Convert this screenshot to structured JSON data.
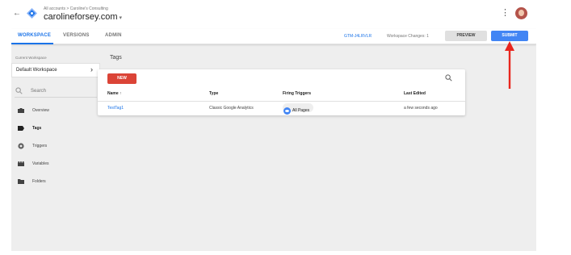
{
  "header": {
    "back_icon": "arrow-left-icon",
    "logo_icon": "gtm-diamond-logo",
    "breadcrumb": "All accounts > Caroline's Consulting",
    "container_name": "carolineforsey.com",
    "container_caret": "▾",
    "menu_icon": "kebab-menu-icon",
    "avatar_icon": "user-avatar"
  },
  "nav": {
    "tabs": [
      {
        "label": "WORKSPACE",
        "active": true
      },
      {
        "label": "VERSIONS",
        "active": false
      },
      {
        "label": "ADMIN",
        "active": false
      }
    ],
    "container_id": "GTM-J4LRVLR",
    "workspace_changes": "Workspace Changes: 1",
    "preview_label": "PREVIEW",
    "submit_label": "SUBMIT"
  },
  "sidebar": {
    "current_workspace_label": "Current Workspace",
    "workspace_name": "Default Workspace",
    "workspace_chevron": "›",
    "search_label": "Search",
    "items": [
      {
        "label": "Overview",
        "icon": "briefcase-icon",
        "active": false
      },
      {
        "label": "Tags",
        "icon": "tag-icon",
        "active": true
      },
      {
        "label": "Triggers",
        "icon": "trigger-icon",
        "active": false
      },
      {
        "label": "Variables",
        "icon": "variables-icon",
        "active": false
      },
      {
        "label": "Folders",
        "icon": "folder-icon",
        "active": false
      }
    ]
  },
  "main": {
    "section_title": "Tags",
    "new_button": "NEW",
    "table": {
      "headers": [
        "Name ↑",
        "Type",
        "Firing Triggers",
        "Last Edited"
      ],
      "rows": [
        {
          "name": "TestTag1",
          "type": "Classic Google Analytics",
          "trigger": "All Pages",
          "last_edited": "a few seconds ago"
        }
      ]
    }
  },
  "colors": {
    "accent_blue": "#1a73e8",
    "submit_blue": "#4285f4",
    "new_red": "#db4437",
    "annotation_red": "#e8261e"
  },
  "annotation": {
    "type": "red-arrow-pointing-to-submit"
  }
}
